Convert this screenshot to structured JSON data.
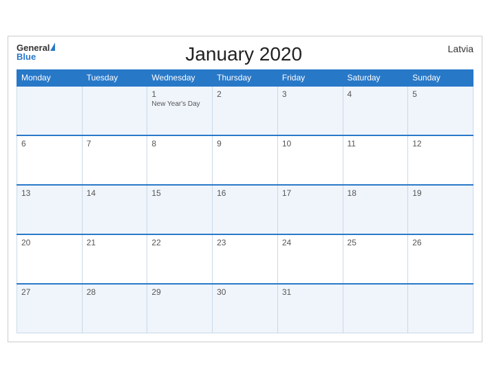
{
  "header": {
    "logo_general": "General",
    "logo_blue": "Blue",
    "title": "January 2020",
    "country": "Latvia"
  },
  "days_of_week": [
    "Monday",
    "Tuesday",
    "Wednesday",
    "Thursday",
    "Friday",
    "Saturday",
    "Sunday"
  ],
  "weeks": [
    [
      {
        "day": "",
        "holiday": ""
      },
      {
        "day": "",
        "holiday": ""
      },
      {
        "day": "1",
        "holiday": "New Year's Day"
      },
      {
        "day": "2",
        "holiday": ""
      },
      {
        "day": "3",
        "holiday": ""
      },
      {
        "day": "4",
        "holiday": ""
      },
      {
        "day": "5",
        "holiday": ""
      }
    ],
    [
      {
        "day": "6",
        "holiday": ""
      },
      {
        "day": "7",
        "holiday": ""
      },
      {
        "day": "8",
        "holiday": ""
      },
      {
        "day": "9",
        "holiday": ""
      },
      {
        "day": "10",
        "holiday": ""
      },
      {
        "day": "11",
        "holiday": ""
      },
      {
        "day": "12",
        "holiday": ""
      }
    ],
    [
      {
        "day": "13",
        "holiday": ""
      },
      {
        "day": "14",
        "holiday": ""
      },
      {
        "day": "15",
        "holiday": ""
      },
      {
        "day": "16",
        "holiday": ""
      },
      {
        "day": "17",
        "holiday": ""
      },
      {
        "day": "18",
        "holiday": ""
      },
      {
        "day": "19",
        "holiday": ""
      }
    ],
    [
      {
        "day": "20",
        "holiday": ""
      },
      {
        "day": "21",
        "holiday": ""
      },
      {
        "day": "22",
        "holiday": ""
      },
      {
        "day": "23",
        "holiday": ""
      },
      {
        "day": "24",
        "holiday": ""
      },
      {
        "day": "25",
        "holiday": ""
      },
      {
        "day": "26",
        "holiday": ""
      }
    ],
    [
      {
        "day": "27",
        "holiday": ""
      },
      {
        "day": "28",
        "holiday": ""
      },
      {
        "day": "29",
        "holiday": ""
      },
      {
        "day": "30",
        "holiday": ""
      },
      {
        "day": "31",
        "holiday": ""
      },
      {
        "day": "",
        "holiday": ""
      },
      {
        "day": "",
        "holiday": ""
      }
    ]
  ]
}
